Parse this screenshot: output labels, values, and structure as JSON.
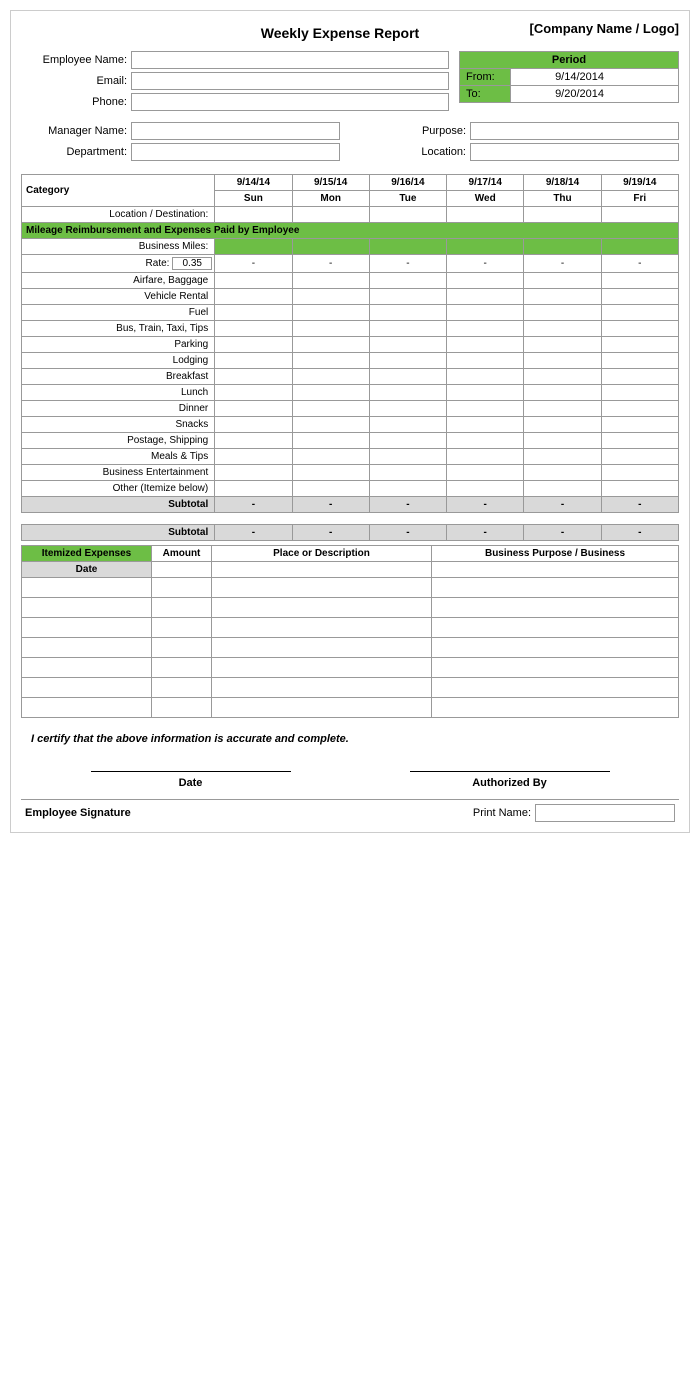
{
  "header": {
    "title": "Weekly Expense Report",
    "company": "[Company Name / Logo]"
  },
  "employee": {
    "name_label": "Employee Name:",
    "email_label": "Email:",
    "phone_label": "Phone:",
    "name_value": "",
    "email_value": "",
    "phone_value": ""
  },
  "period": {
    "header": "Period",
    "from_label": "From:",
    "from_value": "9/14/2014",
    "to_label": "To:",
    "to_value": "9/20/2014"
  },
  "manager": {
    "name_label": "Manager Name:",
    "dept_label": "Department:",
    "purpose_label": "Purpose:",
    "location_label": "Location:"
  },
  "table": {
    "col_category": "Category",
    "dates": [
      "9/14/14",
      "9/15/14",
      "9/16/14",
      "9/17/14",
      "9/18/14",
      "9/19/14"
    ],
    "days": [
      "Sun",
      "Mon",
      "Tue",
      "Wed",
      "Thu",
      "Fri"
    ],
    "location_row": "Location / Destination:",
    "mileage_header": "Mileage Reimbursement and Expenses Paid by Employee",
    "business_miles": "Business Miles:",
    "rate_label": "Rate:",
    "rate_value": "0.35",
    "dash": "-",
    "categories": [
      "Airfare, Baggage",
      "Vehicle Rental",
      "Fuel",
      "Bus, Train, Taxi, Tips",
      "Parking",
      "Lodging",
      "Breakfast",
      "Lunch",
      "Dinner",
      "Snacks",
      "Postage, Shipping",
      "Meals & Tips",
      "Business Entertainment",
      "Other (Itemize below)"
    ],
    "subtotal_label": "Subtotal"
  },
  "itemized": {
    "header": "Itemized Expenses",
    "col_amount": "Amount",
    "col_place": "Place or Description",
    "col_purpose": "Business Purpose / Business",
    "date_label": "Date",
    "rows": 7
  },
  "certification": {
    "text": "I certify that the above information is accurate and complete."
  },
  "signature": {
    "date_label": "Date",
    "authorized_label": "Authorized By",
    "emp_sig_label": "Employee Signature",
    "print_name_label": "Print Name:"
  }
}
